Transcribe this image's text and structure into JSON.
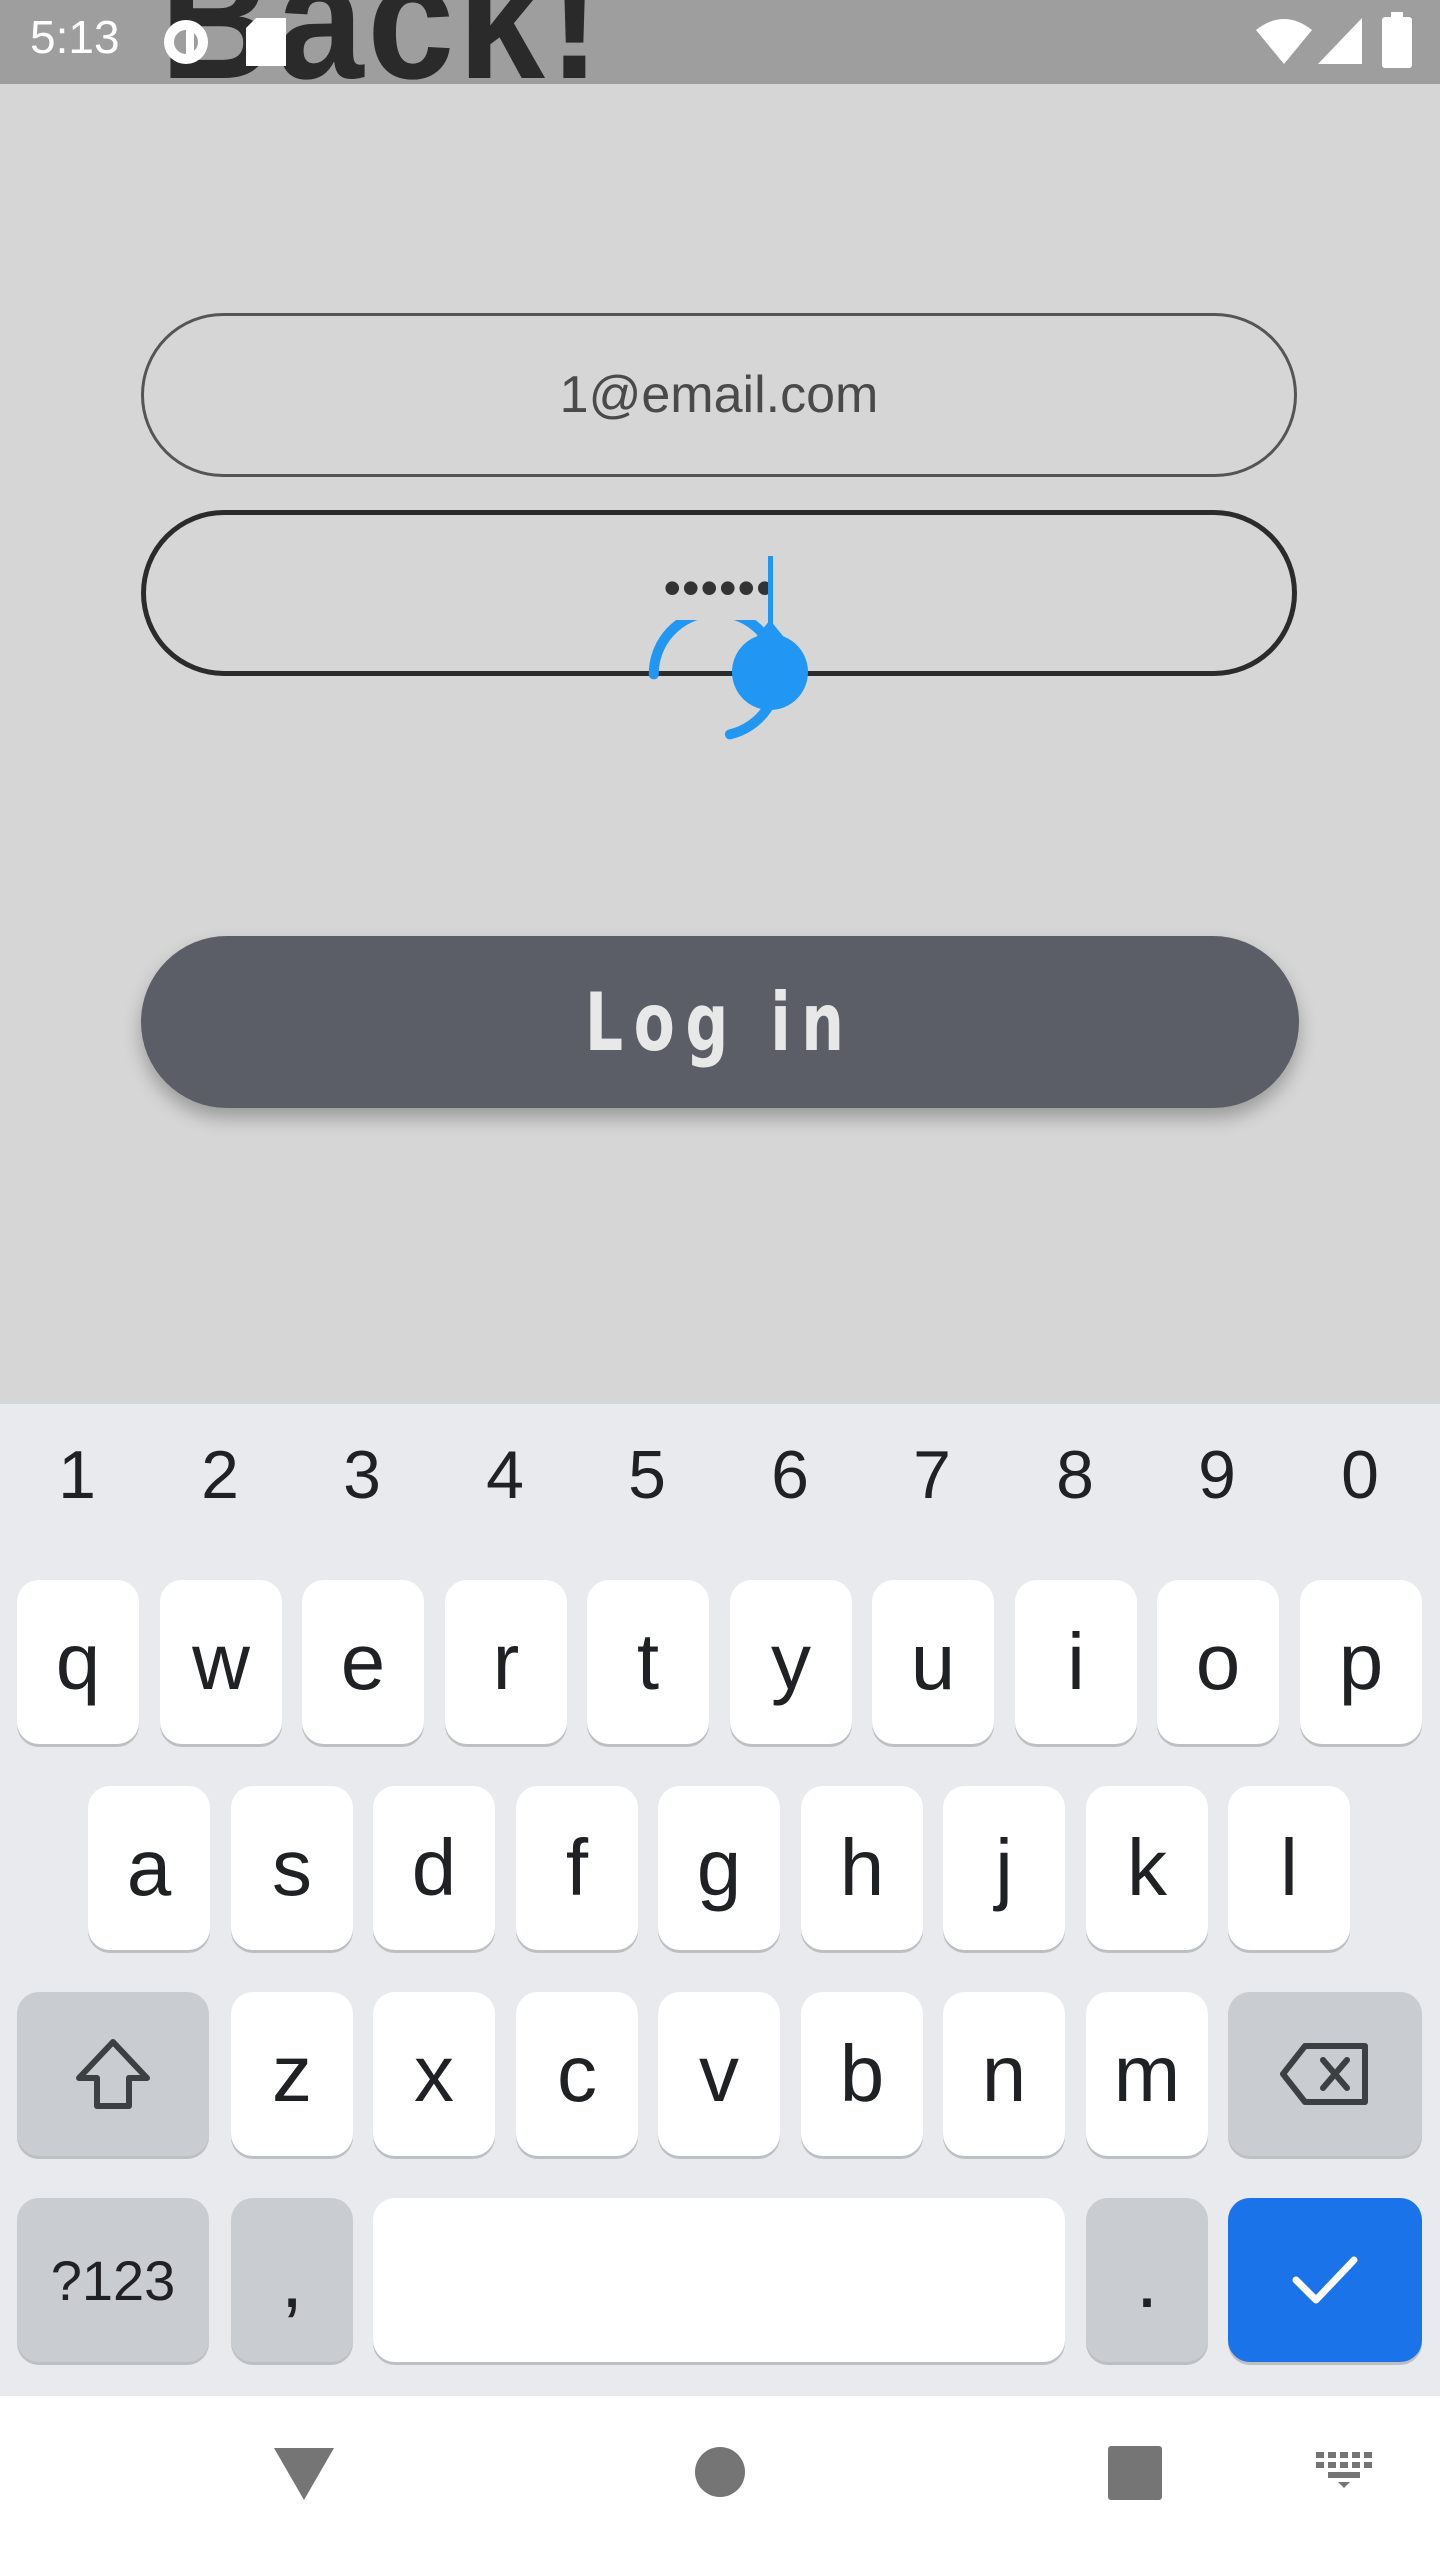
{
  "status_bar": {
    "time": "5:13",
    "icons": [
      "notification-icon",
      "sd-card-icon",
      "wifi-icon",
      "signal-icon",
      "battery-icon"
    ]
  },
  "heading": "Back!",
  "form": {
    "email_value": "1@email.com",
    "password_masked": "••••••",
    "login_label": "Log in"
  },
  "colors": {
    "accent": "#2196f3",
    "button_bg": "#5b5e66",
    "enter_key": "#1a73e8"
  },
  "keyboard": {
    "numbers": [
      "1",
      "2",
      "3",
      "4",
      "5",
      "6",
      "7",
      "8",
      "9",
      "0"
    ],
    "row1": [
      "q",
      "w",
      "e",
      "r",
      "t",
      "y",
      "u",
      "i",
      "o",
      "p"
    ],
    "row2": [
      "a",
      "s",
      "d",
      "f",
      "g",
      "h",
      "j",
      "k",
      "l"
    ],
    "row3": [
      "z",
      "x",
      "c",
      "v",
      "b",
      "n",
      "m"
    ],
    "symbols_label": "?123",
    "comma": ",",
    "period": "."
  },
  "nav_bar": {
    "icons": [
      "back-icon",
      "home-icon",
      "recents-icon",
      "keyboard-switch-icon"
    ]
  }
}
